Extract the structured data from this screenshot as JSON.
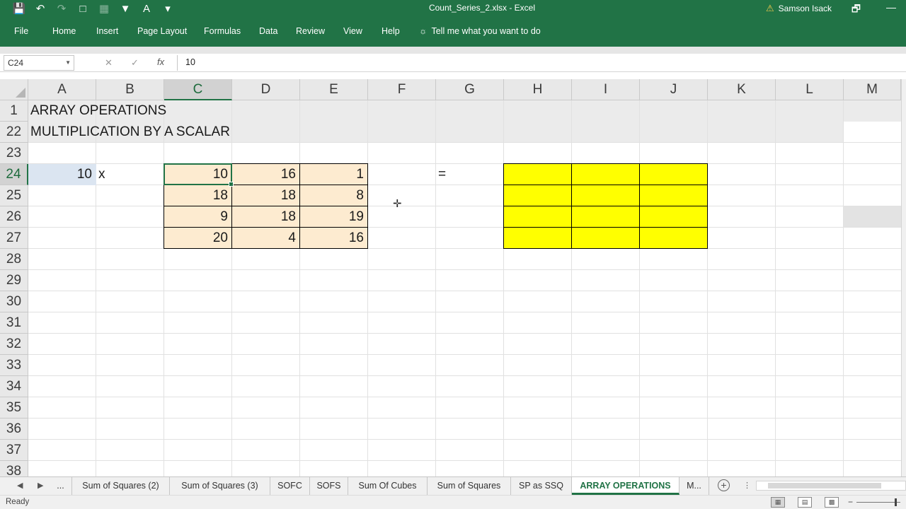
{
  "window": {
    "doc_title": "Count_Series_2.xlsx  -  Excel",
    "user": "Samson Isack",
    "controls": [
      "🗗",
      "—"
    ]
  },
  "ribbon": {
    "tabs": [
      "File",
      "Home",
      "Insert",
      "Page Layout",
      "Formulas",
      "Data",
      "Review",
      "View",
      "Help"
    ],
    "tell_me": "Tell me what you want to do"
  },
  "formula_bar": {
    "name_box": "C24",
    "fx": "fx",
    "value": "10"
  },
  "sheet": {
    "columns": [
      "A",
      "B",
      "C",
      "D",
      "E",
      "F",
      "G",
      "H",
      "I",
      "J",
      "K",
      "L",
      "M"
    ],
    "rows": [
      "1",
      "22",
      "23",
      "24",
      "25",
      "26",
      "27",
      "28",
      "29",
      "30",
      "31",
      "32",
      "33",
      "34",
      "35",
      "36",
      "37",
      "38"
    ],
    "selected_column": "C",
    "selected_row": "24",
    "title": "ARRAY OPERATIONS",
    "subtitle": "MULTIPLICATION BY A SCALAR",
    "scalar": "10",
    "times_sign": "x",
    "equals_sign": "=",
    "matrix": [
      [
        "10",
        "16",
        "1"
      ],
      [
        "18",
        "18",
        "8"
      ],
      [
        "9",
        "18",
        "19"
      ],
      [
        "20",
        "4",
        "16"
      ]
    ],
    "result_fill": "#ffff00",
    "matrix_fill": "#fdebd0"
  },
  "sheet_tabs": {
    "ellipsis": "...",
    "tabs": [
      "Sum of Squares (2)",
      "Sum of Squares (3)",
      "SOFC",
      "SOFS",
      "Sum Of Cubes",
      "Sum of Squares",
      "SP as SSQ",
      "ARRAY OPERATIONS",
      "M..."
    ],
    "active": "ARRAY OPERATIONS"
  },
  "status": {
    "ready": "Ready"
  },
  "accent": "#217346"
}
